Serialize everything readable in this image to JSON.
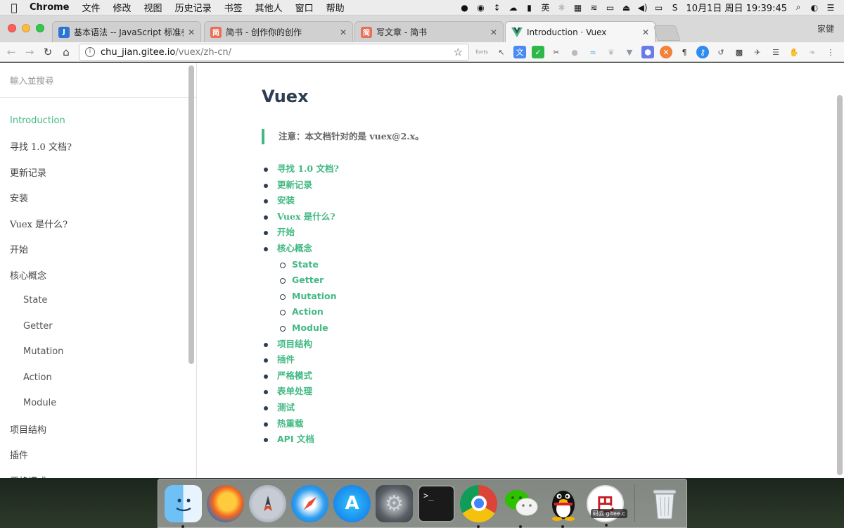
{
  "menubar": {
    "app_name": "Chrome",
    "items": [
      "文件",
      "修改",
      "视图",
      "历史记录",
      "书签",
      "其他人",
      "窗口",
      "帮助"
    ],
    "clock": "10月1日 周日  19:39:45",
    "input_method": "英"
  },
  "browser": {
    "tabs": [
      {
        "title": "基本语法 -- JavaScript 标准参考",
        "favicon": "J",
        "favicon_color": "#2a75d6"
      },
      {
        "title": "简书 - 创作你的创作",
        "favicon": "简",
        "favicon_color": "#ea6f5a"
      },
      {
        "title": "写文章 - 简书",
        "favicon": "简",
        "favicon_color": "#ea6f5a"
      },
      {
        "title": "Introduction · Vuex",
        "favicon": "vue-logo",
        "favicon_color": "#42b983"
      }
    ],
    "profile_name": "家健",
    "url_host": "chu_jian.gitee.io",
    "url_path": "/vuex/zh-cn/",
    "extensions_fonts_label": "fonts"
  },
  "sidebar": {
    "search_placeholder": "輸入並搜尋",
    "items": [
      {
        "label": "Introduction"
      },
      {
        "label": "寻找 1.0 文档?"
      },
      {
        "label": "更新记录"
      },
      {
        "label": "安装"
      },
      {
        "label": "Vuex 是什么?"
      },
      {
        "label": "开始"
      },
      {
        "label": "核心概念"
      },
      {
        "label": "State"
      },
      {
        "label": "Getter"
      },
      {
        "label": "Mutation"
      },
      {
        "label": "Action"
      },
      {
        "label": "Module"
      },
      {
        "label": "项目结构"
      },
      {
        "label": "插件"
      },
      {
        "label": "严格模式"
      }
    ]
  },
  "main": {
    "title": "Vuex",
    "note": "注意：本文档针对的是 vuex@2.x。",
    "toc": [
      {
        "label": "寻找 1.0 文档?"
      },
      {
        "label": "更新记录"
      },
      {
        "label": "安装"
      },
      {
        "label": "Vuex 是什么?"
      },
      {
        "label": "开始"
      },
      {
        "label": "核心概念"
      },
      {
        "label": "State"
      },
      {
        "label": "Getter"
      },
      {
        "label": "Mutation"
      },
      {
        "label": "Action"
      },
      {
        "label": "Module"
      },
      {
        "label": "项目结构"
      },
      {
        "label": "插件"
      },
      {
        "label": "严格模式"
      },
      {
        "label": "表单处理"
      },
      {
        "label": "测试"
      },
      {
        "label": "热重载"
      },
      {
        "label": "API 文档"
      }
    ]
  },
  "dock": {
    "apps": [
      "Finder",
      "Firefox",
      "Launchpad",
      "Safari",
      "App Store",
      "System Preferences",
      "Terminal",
      "Chrome",
      "WeChat",
      "QQ",
      "码云 gitee"
    ],
    "gitee_label": "码云 gitee.c"
  },
  "colors": {
    "accent": "#42b983",
    "heading": "#2c3e50"
  }
}
